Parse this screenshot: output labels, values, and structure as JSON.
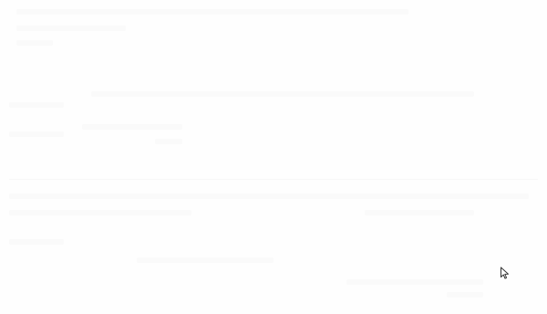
{
  "screen": {
    "background": "#fefefe"
  },
  "cursor": {
    "icon": "mouse-pointer-icon",
    "color": "#333333"
  }
}
